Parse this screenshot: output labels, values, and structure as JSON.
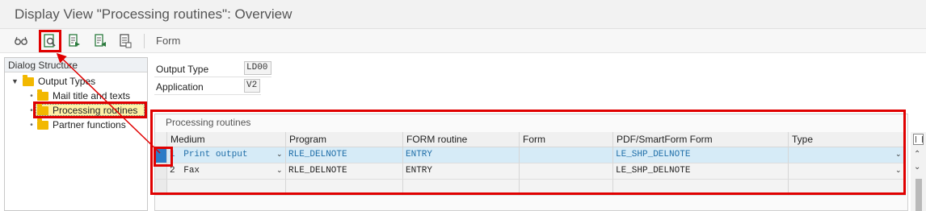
{
  "window": {
    "title": "Display View \"Processing routines\": Overview"
  },
  "toolbar": {
    "icons": [
      "glasses-icon",
      "find-icon",
      "previous-entry-icon",
      "next-entry-icon",
      "select-all-icon"
    ],
    "form_label": "Form"
  },
  "dialog_structure": {
    "title": "Dialog Structure",
    "items": [
      {
        "label": "Output Types",
        "level": 0,
        "expanded": true
      },
      {
        "label": "Mail title and texts",
        "level": 1
      },
      {
        "label": "Processing routines",
        "level": 1,
        "selected": true
      },
      {
        "label": "Partner functions",
        "level": 1
      }
    ]
  },
  "header_fields": {
    "output_type": {
      "label": "Output Type",
      "value": "LD00"
    },
    "application": {
      "label": "Application",
      "value": "V2"
    }
  },
  "table": {
    "title": "Processing routines",
    "columns": [
      "Medium",
      "Program",
      "FORM routine",
      "Form",
      "PDF/SmartForm Form",
      "Type"
    ],
    "rows": [
      {
        "medium_code": "1",
        "medium": "Print output",
        "program": "RLE_DELNOTE",
        "form_routine": "ENTRY",
        "form": "",
        "pdf_form": "LE_SHP_DELNOTE",
        "type": "",
        "selected": true
      },
      {
        "medium_code": "2",
        "medium": "Fax",
        "program": "RLE_DELNOTE",
        "form_routine": "ENTRY",
        "form": "",
        "pdf_form": "LE_SHP_DELNOTE",
        "type": ""
      }
    ]
  },
  "colors": {
    "highlight": "#e00000",
    "selected_row": "#d6ebf7",
    "selected_text": "#1f6ea8",
    "folder": "#f2b800"
  }
}
